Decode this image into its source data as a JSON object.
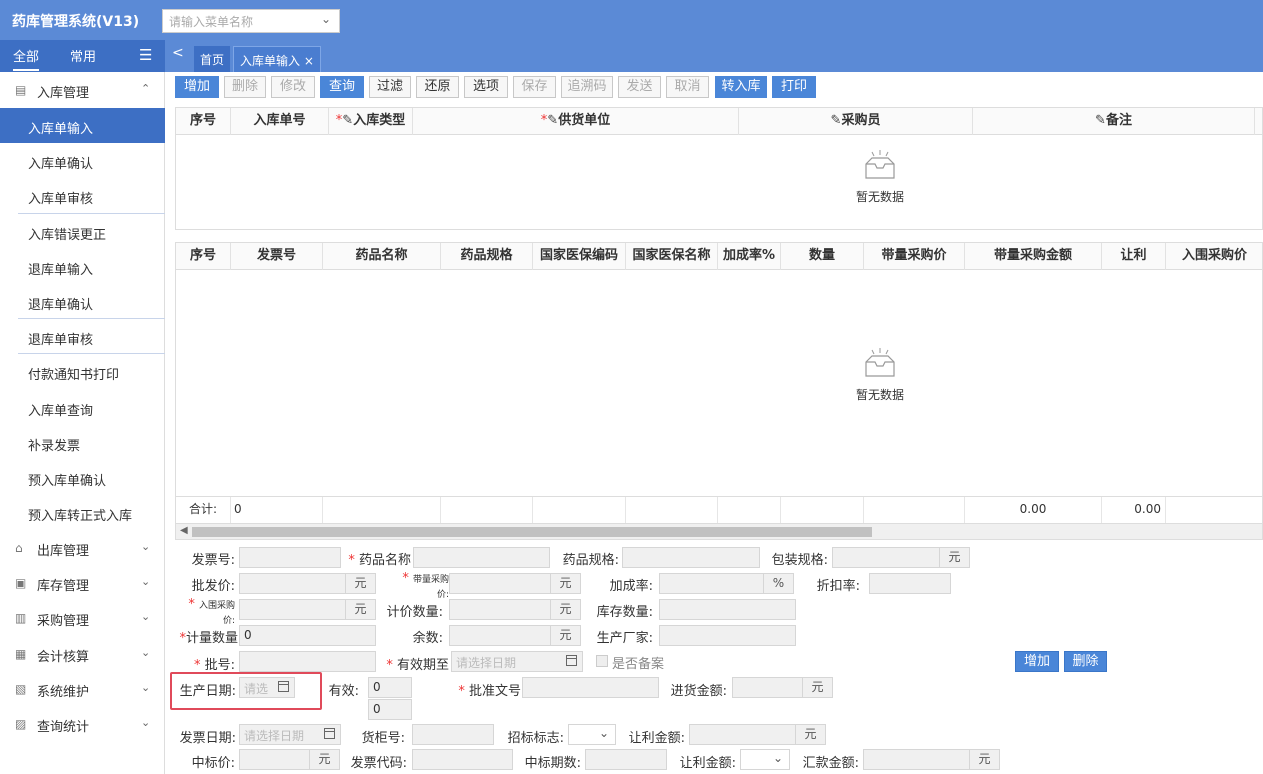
{
  "app": {
    "title": "药库管理系统(V13)",
    "search_placeholder": "请输入菜单名称"
  },
  "sidebar": {
    "tabs": [
      "全部",
      "常用"
    ],
    "groups": [
      {
        "label": "入库管理",
        "icon": "inbox-icon",
        "expanded": true
      },
      {
        "label": "出库管理",
        "icon": "home-icon"
      },
      {
        "label": "库存管理",
        "icon": "storage-icon"
      },
      {
        "label": "采购管理",
        "icon": "cart-icon"
      },
      {
        "label": "会计核算",
        "icon": "calculator-icon"
      },
      {
        "label": "系统维护",
        "icon": "monitor-icon"
      },
      {
        "label": "查询统计",
        "icon": "query-icon"
      }
    ],
    "items": [
      "入库单输入",
      "入库单确认",
      "入库单审核",
      "入库错误更正",
      "退库单输入",
      "退库单确认",
      "退库单审核",
      "付款通知书打印",
      "入库单查询",
      "补录发票",
      "预入库单确认",
      "预入库转正式入库"
    ]
  },
  "tabs": {
    "home": "首页",
    "current": "入库单输入"
  },
  "toolbar": {
    "add": "增加",
    "delete": "删除",
    "modify": "修改",
    "query": "查询",
    "filter": "过滤",
    "restore": "还原",
    "options": "选项",
    "save": "保存",
    "trace": "追溯码",
    "send": "发送",
    "cancel": "取消",
    "transfer": "转入库",
    "print": "打印"
  },
  "grid1": {
    "headers": [
      "序号",
      "入库单号",
      "入库类型",
      "供货单位",
      "采购员",
      "备注"
    ],
    "required_mark": "*",
    "empty_text": "暂无数据"
  },
  "grid2": {
    "headers": [
      "序号",
      "发票号",
      "药品名称",
      "药品规格",
      "国家医保编码",
      "国家医保名称",
      "加成率%",
      "数量",
      "带量采购价",
      "带量采购金额",
      "让利",
      "入围采购价"
    ],
    "empty_text": "暂无数据",
    "sum_label": "合计:",
    "sum_count": "0",
    "sum_amount": "0.00",
    "sum_rebate": "0.00"
  },
  "form": {
    "invoice_no": "发票号:",
    "drug_name": "药品名称",
    "drug_spec": "药品规格:",
    "pack_spec": "包装规格:",
    "wholesale": "批发价:",
    "vol_price_a": "带量采购",
    "vol_price_b": "价:",
    "markup": "加成率:",
    "discount": "折扣率:",
    "shortlist_a": "入围采购",
    "shortlist_b": "价:",
    "price_qty": "计价数量:",
    "stock_qty": "库存数量:",
    "meas_qty": "计量数量",
    "meas_qty_value": "0",
    "remainder": "余数:",
    "manufacturer": "生产厂家:",
    "batch": "批号:",
    "expiry": "有效期至",
    "date_placeholder": "请选择日期",
    "filed": "是否备案",
    "add": "增加",
    "delete": "删除",
    "prod_date": "生产日期:",
    "select_short": "请选",
    "valid": "有效:",
    "valid_val1": "0",
    "valid_val2": "0",
    "approval": "批准文号",
    "purchase_amt": "进货金额:",
    "invoice_date": "发票日期:",
    "shelf_no": "货柜号:",
    "bid_flag": "招标标志:",
    "rebate_amt": "让利金额:",
    "bid_price": "中标价:",
    "invoice_code": "发票代码:",
    "bid_period": "中标期数:",
    "rebate_amt2": "让利金额:",
    "remit_amt": "汇款金额:",
    "unit_yuan": "元",
    "unit_pct": "%",
    "req": "*"
  }
}
